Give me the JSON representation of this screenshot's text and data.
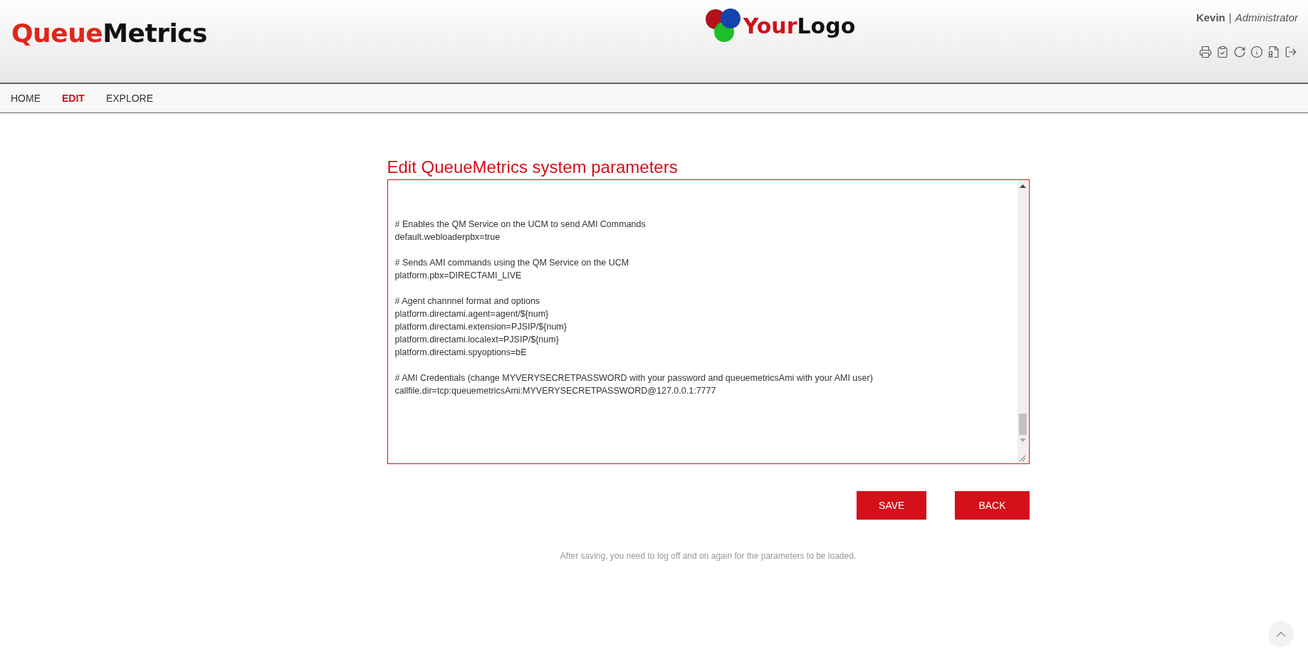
{
  "header": {
    "brand": [
      {
        "text": "Queue",
        "color": "#e0261b"
      },
      {
        "text": "Metrics",
        "color": "#111111"
      }
    ],
    "partner_logo": [
      {
        "text": "Your",
        "color": "#d0101a"
      },
      {
        "text": "Logo",
        "color": "#111111"
      }
    ],
    "user": {
      "name": "Kevin",
      "separator": "|",
      "role": "Administrator"
    },
    "toolbar": [
      {
        "kind": "print"
      },
      {
        "kind": "checklist"
      },
      {
        "kind": "refresh"
      },
      {
        "kind": "info"
      },
      {
        "kind": "certificate"
      },
      {
        "kind": "logout"
      }
    ]
  },
  "nav": [
    {
      "label": "HOME",
      "selected": false
    },
    {
      "label": "EDIT",
      "selected": true
    },
    {
      "label": "EXPLORE",
      "selected": false
    }
  ],
  "title": "Edit QueueMetrics system parameters",
  "editor": {
    "value": "# Enables the QM Service on the UCM to send AMI Commands\ndefault.webloaderpbx=true\n\n# Sends AMI commands using the QM Service on the UCM\nplatform.pbx=DIRECTAMI_LIVE\n\n# Agent channnel format and options\nplatform.directami.agent=agent/${num}\nplatform.directami.extension=PJSIP/${num}\nplatform.directami.localext=PJSIP/${num}\nplatform.directami.spyoptions=bE\n\n# AMI Credentials (change MYVERYSECRETPASSWORD with your password and queuemetricsAmi with your AMI user)\ncallfile.dir=tcp:queuemetricsAmi:MYVERYSECRETPASSWORD@127.0.0.1:7777"
  },
  "buttons": [
    "SAVE",
    "BACK"
  ],
  "note": "After saving, you need to log off and on again for the parameters to be loaded."
}
